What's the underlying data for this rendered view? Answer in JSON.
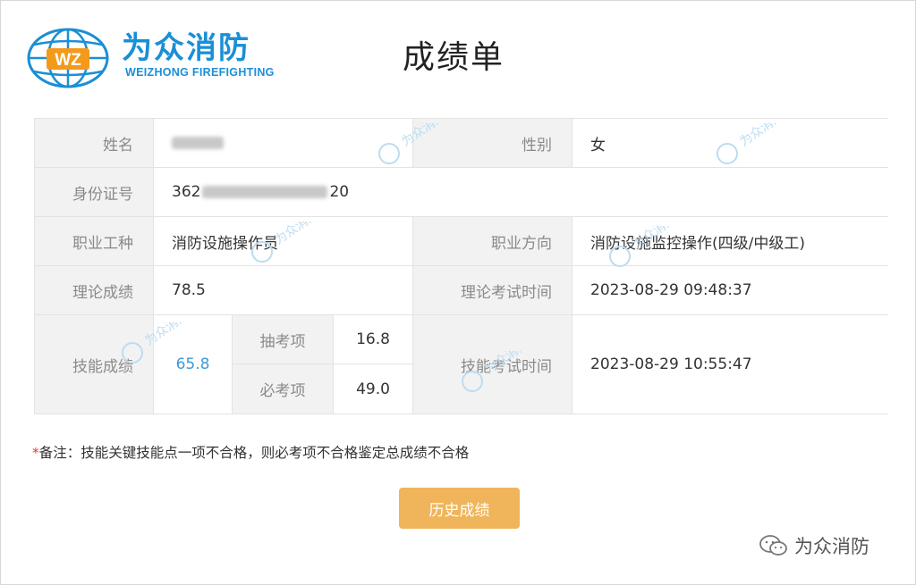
{
  "logo": {
    "cn": "为众消防",
    "en": "WEIZHONG FIREFIGHTING",
    "badge": "WZ"
  },
  "title": "成绩单",
  "rows": {
    "name_label": "姓名",
    "name_value": "",
    "gender_label": "性别",
    "gender_value": "女",
    "id_label": "身份证号",
    "id_prefix": "362",
    "id_suffix": "20",
    "occupation_label": "职业工种",
    "occupation_value": "消防设施操作员",
    "direction_label": "职业方向",
    "direction_value": "消防设施监控操作(四级/中级工)",
    "theory_label": "理论成绩",
    "theory_value": "78.5",
    "theory_time_label": "理论考试时间",
    "theory_time_value": "2023-08-29 09:48:37",
    "skill_label": "技能成绩",
    "skill_value": "65.8",
    "sample_label": "抽考项",
    "sample_value": "16.8",
    "required_label": "必考项",
    "required_value": "49.0",
    "skill_time_label": "技能考试时间",
    "skill_time_value": "2023-08-29 10:55:47"
  },
  "note": {
    "star": "*",
    "text": "备注：技能关键技能点一项不合格，则必考项不合格鉴定总成绩不合格"
  },
  "button": {
    "history": "历史成绩"
  },
  "footer": {
    "brand": "为众消防",
    "icon": "wechat-icon"
  },
  "colors": {
    "brand_blue": "#1a8fd6",
    "button": "#f0b55a",
    "score_blue": "#3d9ad8",
    "label_bg": "#f2f2f2"
  }
}
